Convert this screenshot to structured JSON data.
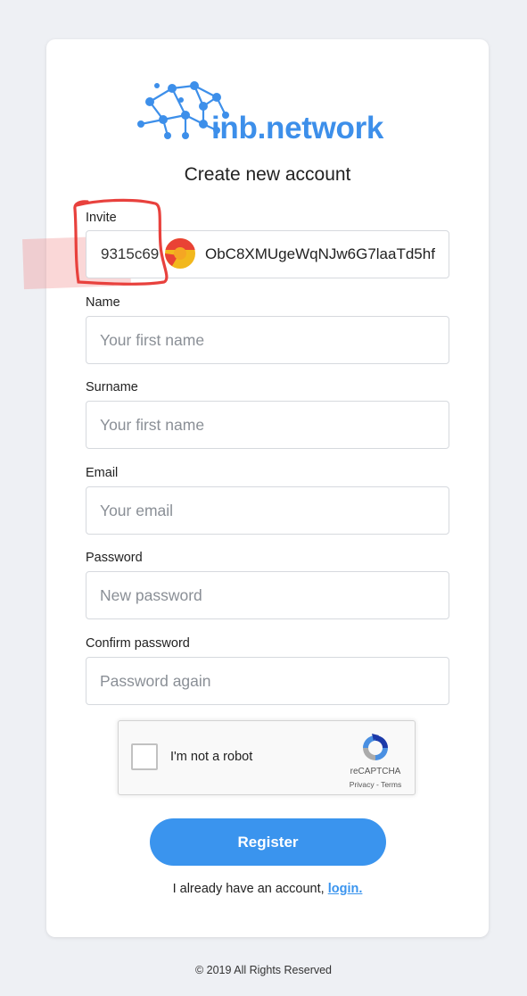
{
  "brand": {
    "name": "inb.network",
    "color": "#3d8fea"
  },
  "title": "Create new account",
  "form": {
    "invite": {
      "label": "Invite",
      "value_part1": "9315c69",
      "value_part2": "ObC8XMUgeWqNJw6G7laaTd5hf"
    },
    "name": {
      "label": "Name",
      "placeholder": "Your first name"
    },
    "surname": {
      "label": "Surname",
      "placeholder": "Your first name"
    },
    "email": {
      "label": "Email",
      "placeholder": "Your email"
    },
    "password": {
      "label": "Password",
      "placeholder": "New password"
    },
    "confirm_password": {
      "label": "Confirm password",
      "placeholder": "Password again"
    }
  },
  "recaptcha": {
    "label": "I'm not a robot",
    "brand": "reCAPTCHA",
    "privacy": "Privacy",
    "separator": " - ",
    "terms": "Terms",
    "checked": false
  },
  "register_button": "Register",
  "login_prompt": {
    "text": "I already have an account, ",
    "link": "login."
  },
  "footer": "© 2019 All Rights Reserved",
  "icons": [
    "network-logo-icon",
    "chrome-icon",
    "recaptcha-icon"
  ],
  "colors": {
    "accent": "#3a94ee",
    "background": "#eef0f4",
    "annotation": "#e8413d"
  }
}
